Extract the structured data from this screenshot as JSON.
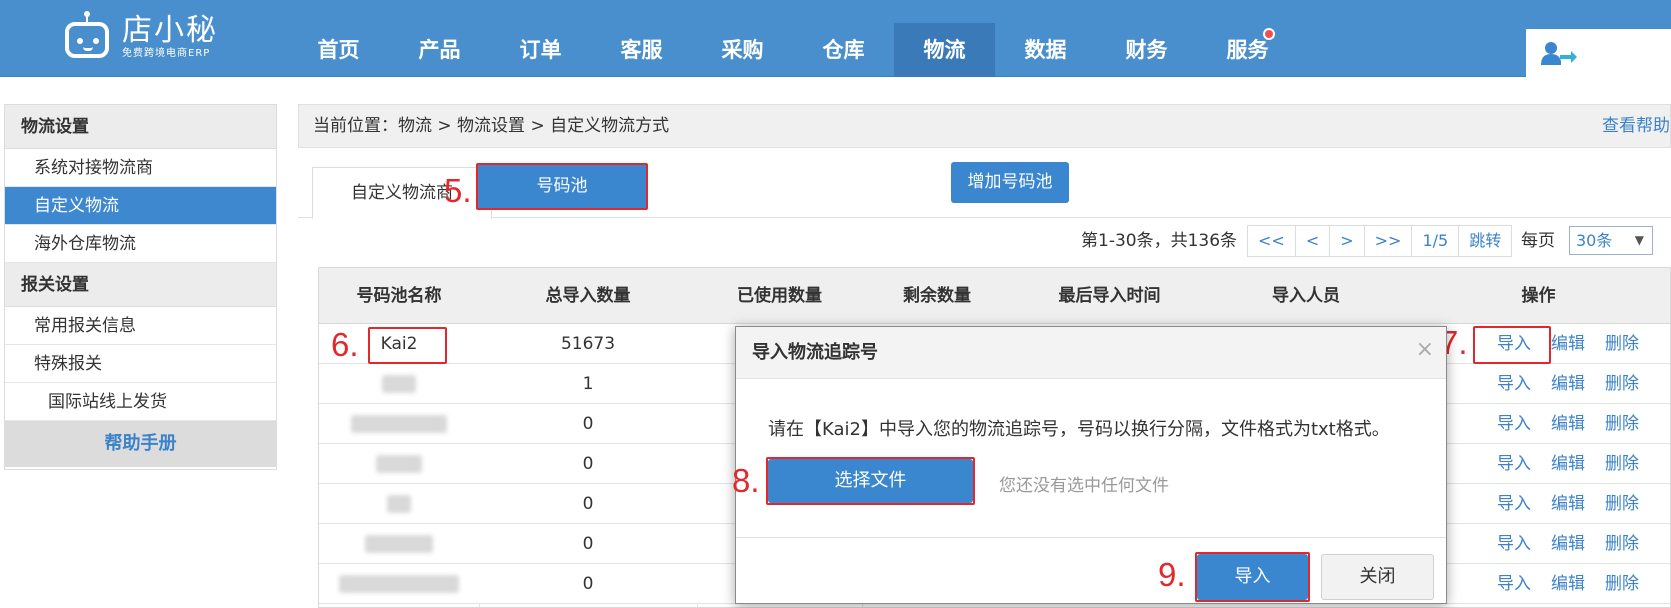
{
  "brand": {
    "name": "店小秘",
    "sub": "免费跨境电商ERP"
  },
  "nav": {
    "items": [
      {
        "label": "首页",
        "active": false
      },
      {
        "label": "产品",
        "active": false
      },
      {
        "label": "订单",
        "active": false
      },
      {
        "label": "客服",
        "active": false
      },
      {
        "label": "采购",
        "active": false
      },
      {
        "label": "仓库",
        "active": false
      },
      {
        "label": "物流",
        "active": true
      },
      {
        "label": "数据",
        "active": false
      },
      {
        "label": "财务",
        "active": false
      },
      {
        "label": "服务",
        "active": false,
        "badge_dot": true
      }
    ]
  },
  "sidebar": {
    "section1": "物流设置",
    "items1": [
      "系统对接物流商",
      "自定义物流",
      "海外仓库物流"
    ],
    "active_item": "自定义物流",
    "section2": "报关设置",
    "items2": [
      "常用报关信息",
      "特殊报关",
      "国际站线上发货"
    ],
    "help": "帮助手册"
  },
  "breadcrumb": {
    "text": "当前位置：物流 > 物流设置 > 自定义物流方式",
    "help": "查看帮助"
  },
  "tabs": {
    "tab1": "自定义物流商",
    "tab2": "号码池",
    "add_button": "增加号码池"
  },
  "pager": {
    "info": "第1-30条，共136条",
    "buttons": [
      "<<",
      "<",
      ">",
      ">>",
      "1/5",
      "跳转"
    ],
    "per_page_label": "每页",
    "per_page_value": "30条"
  },
  "table": {
    "headers": [
      "号码池名称",
      "总导入数量",
      "已使用数量",
      "剩余数量",
      "最后导入时间",
      "导入人员",
      "操作"
    ],
    "rows": [
      {
        "name": "Kai2",
        "total": "51673"
      },
      {
        "name": "",
        "total": "1"
      },
      {
        "name": "",
        "total": "0"
      },
      {
        "name": "",
        "total": "0"
      },
      {
        "name": "",
        "total": "0"
      },
      {
        "name": "",
        "total": "0"
      },
      {
        "name": "",
        "total": "0"
      }
    ],
    "ops": {
      "import": "导入",
      "edit": "编辑",
      "delete": "删除"
    }
  },
  "modal": {
    "title": "导入物流追踪号",
    "close": "×",
    "message": "请在【Kai2】中导入您的物流追踪号，号码以换行分隔，文件格式为txt格式。",
    "choose_file": "选择文件",
    "no_file": "您还没有选中任何文件",
    "import": "导入",
    "close_button": "关闭"
  },
  "steps": {
    "s5": "5.",
    "s6": "6.",
    "s7": "7.",
    "s8": "8.",
    "s9": "9."
  },
  "colors": {
    "topbar": "#4a8fcd",
    "primary": "#3a86cf",
    "annotation": "#e3272d",
    "link": "#3b82c9"
  },
  "icons": {
    "user": "user-switch-icon",
    "logo": "robot-logo-icon"
  }
}
